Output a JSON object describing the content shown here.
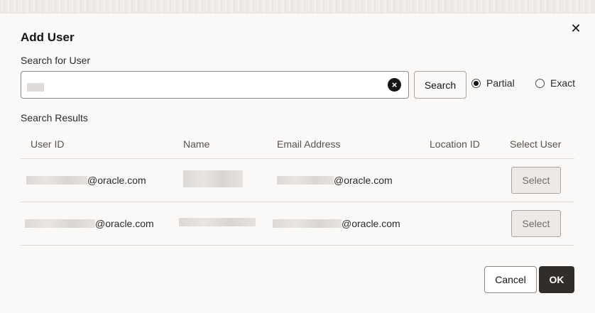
{
  "dialog": {
    "title": "Add User",
    "close_icon": "close-icon"
  },
  "search": {
    "label": "Search for User",
    "button_label": "Search",
    "clear_icon": "clear-circle-icon",
    "modes": [
      {
        "label": "Partial",
        "checked": true
      },
      {
        "label": "Exact",
        "checked": false
      }
    ]
  },
  "results": {
    "label": "Search Results",
    "columns": [
      "User ID",
      "Name",
      "Email Address",
      "Location ID",
      "Select User"
    ],
    "rows": [
      {
        "user_id_suffix": "@oracle.com",
        "email_suffix": "@oracle.com",
        "location_id": "",
        "select_label": "Select"
      },
      {
        "user_id_suffix": "@oracle.com",
        "email_suffix": "@oracle.com",
        "location_id": "",
        "select_label": "Select"
      }
    ]
  },
  "footer": {
    "cancel_label": "Cancel",
    "ok_label": "OK"
  }
}
